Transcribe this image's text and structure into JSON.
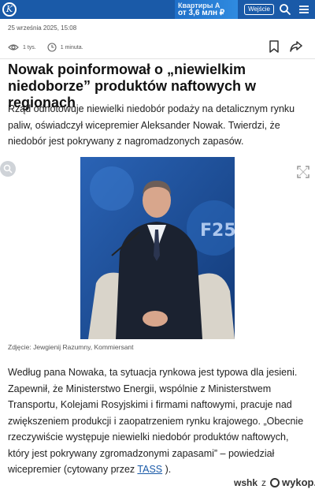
{
  "header": {
    "logo_letter": "K",
    "ad_line1": "Квартиры А",
    "ad_line2": "от 3,6 млн ₽",
    "login_label": "Wejście",
    "colors": {
      "bar": "#1a5aa8"
    },
    "icons": [
      "kommersant-logo-icon",
      "search-icon",
      "menu-icon"
    ]
  },
  "article": {
    "date": "25 września 2025, 15:08",
    "views": "1 tys.",
    "read_time": "1 minuta.",
    "title": "Nowak poinformował o „niewielkim niedoborze” produktów naftowych w regionach",
    "lead": "Rząd odnotowuje niewielki niedobór podaży na detalicznym rynku paliw, oświadczył wicepremier Aleksander Nowak. Twierdzi, że niedobór jest pokrywany z nagromadzonych zapasów.",
    "caption": "Zdjęcie: Jewgienij Razumny, Kommiersant",
    "body_before_link": "Według pana Nowaka, ta sytuacja rynkowa jest typowa dla jesieni. Zapewnił, że Ministerstwo Energii, wspólnie z Ministerstwem Transportu, Kolejami Rosyjskimi i firmami naftowymi, pracuje nad zwiększeniem produkcji i zaopatrzeniem rynku krajowego. „Obecnie rzeczywiście występuje niewielki niedobór produktów naftowych, który jest pokrywany zgromadzonymi zapasami” – powiedział wicepremier (cytowany przez ",
    "body_link": "TASS",
    "body_after_link": " ).",
    "photo_backdrop_text": "F25"
  },
  "watermark": {
    "user": "wshk",
    "sep": "z",
    "brand": "wykop.pl"
  }
}
